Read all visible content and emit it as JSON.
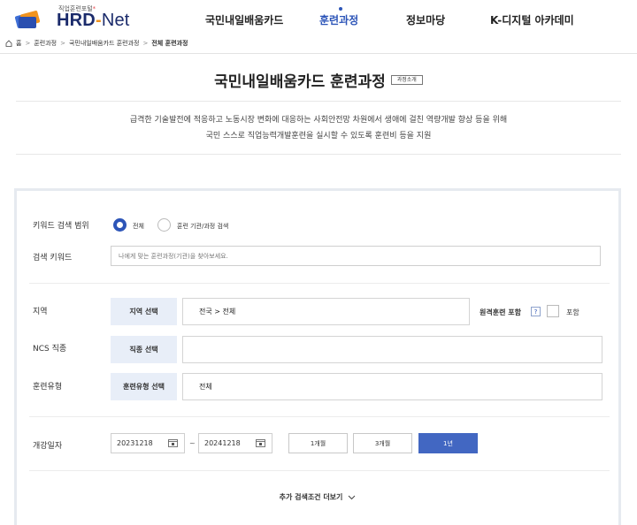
{
  "header": {
    "logo_sub": "직업훈련포털",
    "logo_star": "*",
    "logo_hrd": "HRD",
    "logo_dash": "-",
    "logo_net": "Net",
    "nav": [
      {
        "label": "국민내일배움카드",
        "active": false
      },
      {
        "label": "훈련과정",
        "active": true
      },
      {
        "label": "정보마당",
        "active": false
      },
      {
        "label": "K-디지털 아카데미",
        "active": false
      }
    ]
  },
  "breadcrumb": {
    "home": "홈",
    "items": [
      "훈련과정",
      "국민내일배움카드 훈련과정"
    ],
    "current": "전체 훈련과정"
  },
  "page": {
    "title": "국민내일배움카드 훈련과정",
    "intro_button": "과정소개",
    "description_line1": "급격한 기술발전에 적응하고 노동시장 변화에 대응하는 사회안전망 차원에서 생애에 걸친 역량개발 향상 등을 위해",
    "description_line2": "국민 스스로 직업능력개발훈련을 실시할 수 있도록 훈련비 등을 지원"
  },
  "search": {
    "scope_label": "키워드 검색 범위",
    "scope_options": [
      {
        "label": "전체",
        "checked": true
      },
      {
        "label": "훈련 기관/과정 검색",
        "checked": false
      }
    ],
    "keyword_label": "검색 키워드",
    "keyword_placeholder": "나에게 맞는 훈련과정(기관)을 찾아보세요.",
    "region_label": "지역",
    "region_button": "지역 선택",
    "region_value": "전국 > 전체",
    "remote_label": "원격훈련 포함",
    "help": "?",
    "remote_check_label": "포함",
    "ncs_label": "NCS 직종",
    "ncs_button": "직종 선택",
    "ncs_value": "",
    "type_label": "훈련유형",
    "type_button": "훈련유형 선택",
    "type_value": "전체",
    "date_label": "개강일자",
    "date_start": "20231218",
    "date_end": "20241218",
    "tilde": "~",
    "periods": [
      {
        "label": "1개월",
        "active": false
      },
      {
        "label": "3개월",
        "active": false
      },
      {
        "label": "1년",
        "active": true
      }
    ],
    "more_button": "추가 검색조건 더보기"
  },
  "colors": {
    "accent": "#2d55b8",
    "active_button": "#4267c2",
    "select_bg": "#e8eef8",
    "logo_navy": "#1b2b6b",
    "logo_orange": "#f0931e"
  }
}
